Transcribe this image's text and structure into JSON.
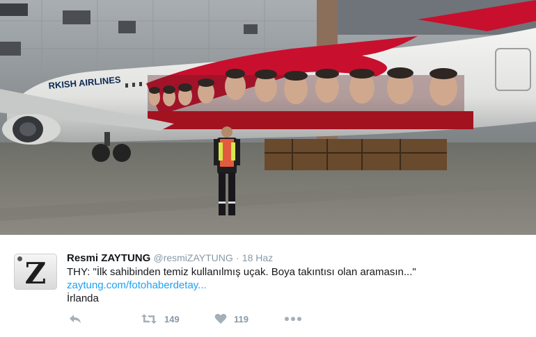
{
  "photo": {
    "alt_description": "",
    "fuselage_text": "RKISH AIRLINES"
  },
  "tweet": {
    "author_name": "Resmi ZAYTUNG",
    "handle": "@resmiZAYTUNG",
    "separator": "·",
    "date": "18 Haz",
    "text": "THY: \"İlk sahibinden temiz kullanılmış uçak. Boya takıntısı olan aramasın...\"",
    "link": "zaytung.com/fotohaberdetay...",
    "place": "İrlanda",
    "avatar_letter": "Z"
  },
  "actions": {
    "retweet_count": "149",
    "like_count": "119",
    "reply_icon": "reply-icon",
    "retweet_icon": "retweet-icon",
    "like_icon": "heart-icon",
    "more_icon": "more-icon",
    "icon_color": "#a4afb8"
  },
  "colors": {
    "link": "#1da1f2",
    "muted": "#8899a6",
    "text": "#14171a",
    "livery_red": "#c8102e"
  }
}
